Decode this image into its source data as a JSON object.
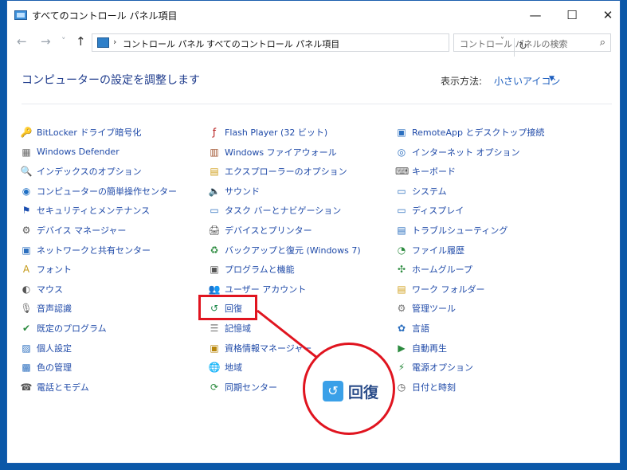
{
  "window": {
    "title": "すべてのコントロール パネル項目",
    "controls": {
      "minimize": "—",
      "maximize": "☐",
      "close": "✕"
    }
  },
  "nav": {
    "back": "←",
    "forward": "→",
    "recent": "˅",
    "up": "↑",
    "breadcrumb": [
      "コントロール パネル",
      "すべてのコントロール パネル項目"
    ],
    "separator": "›",
    "dropdown": "˅",
    "refresh": "↻",
    "search_placeholder": "コントロール パネルの検索",
    "search_icon": "⌕"
  },
  "header": {
    "title": "コンピューターの設定を調整します",
    "view_by_label": "表示方法:",
    "view_by_value": "小さいアイコン",
    "view_by_arrow": "▼"
  },
  "columns": [
    [
      {
        "label": "BitLocker ドライブ暗号化",
        "icon": "key-icon",
        "glyph": "🔑",
        "color": "#c9a21b"
      },
      {
        "label": "Windows Defender",
        "icon": "wall-icon",
        "glyph": "▦",
        "color": "#6b6b6b"
      },
      {
        "label": "インデックスのオプション",
        "icon": "magnifier-icon",
        "glyph": "🔍",
        "color": "#555555"
      },
      {
        "label": "コンピューターの簡単操作センター",
        "icon": "ease-of-access-icon",
        "glyph": "◉",
        "color": "#1f6fc4"
      },
      {
        "label": "セキュリティとメンテナンス",
        "icon": "flag-icon",
        "glyph": "⚑",
        "color": "#1c4fb0"
      },
      {
        "label": "デバイス マネージャー",
        "icon": "device-manager-icon",
        "glyph": "⚙",
        "color": "#555555"
      },
      {
        "label": "ネットワークと共有センター",
        "icon": "network-icon",
        "glyph": "▣",
        "color": "#2c6fbf"
      },
      {
        "label": "フォント",
        "icon": "font-icon",
        "glyph": "A",
        "color": "#c49a18"
      },
      {
        "label": "マウス",
        "icon": "mouse-icon",
        "glyph": "◐",
        "color": "#555555"
      },
      {
        "label": "音声認識",
        "icon": "microphone-icon",
        "glyph": "🎙",
        "color": "#666666"
      },
      {
        "label": "既定のプログラム",
        "icon": "default-programs-icon",
        "glyph": "✔",
        "color": "#2b8a3e"
      },
      {
        "label": "個人設定",
        "icon": "personalization-icon",
        "glyph": "▨",
        "color": "#2c6fbf"
      },
      {
        "label": "色の管理",
        "icon": "color-management-icon",
        "glyph": "▩",
        "color": "#2c6fbf"
      },
      {
        "label": "電話とモデム",
        "icon": "phone-modem-icon",
        "glyph": "☎",
        "color": "#555555"
      }
    ],
    [
      {
        "label": "Flash Player (32 ビット)",
        "icon": "flash-icon",
        "glyph": "ƒ",
        "color": "#b31212"
      },
      {
        "label": "Windows ファイアウォール",
        "icon": "firewall-icon",
        "glyph": "▥",
        "color": "#a0522d"
      },
      {
        "label": "エクスプローラーのオプション",
        "icon": "folder-options-icon",
        "glyph": "▤",
        "color": "#d1a11f"
      },
      {
        "label": "サウンド",
        "icon": "speaker-icon",
        "glyph": "🔈",
        "color": "#777777"
      },
      {
        "label": "タスク バーとナビゲーション",
        "icon": "taskbar-icon",
        "glyph": "▭",
        "color": "#2c6fbf"
      },
      {
        "label": "デバイスとプリンター",
        "icon": "printer-icon",
        "glyph": "🖨",
        "color": "#555555"
      },
      {
        "label": "バックアップと復元 (Windows 7)",
        "icon": "backup-icon",
        "glyph": "♻",
        "color": "#2b8a3e"
      },
      {
        "label": "プログラムと機能",
        "icon": "programs-icon",
        "glyph": "▣",
        "color": "#555555"
      },
      {
        "label": "ユーザー アカウント",
        "icon": "user-accounts-icon",
        "glyph": "👥",
        "color": "#2c6fbf"
      },
      {
        "label": "回復",
        "icon": "recovery-icon",
        "glyph": "↺",
        "color": "#1f8a4c"
      },
      {
        "label": "記憶域",
        "icon": "storage-icon",
        "glyph": "☰",
        "color": "#777777"
      },
      {
        "label": "資格情報マネージャー",
        "icon": "credential-icon",
        "glyph": "▣",
        "color": "#b8860b"
      },
      {
        "label": "地域",
        "icon": "globe-icon",
        "glyph": "🌐",
        "color": "#2c6fbf"
      },
      {
        "label": "同期センター",
        "icon": "sync-icon",
        "glyph": "⟳",
        "color": "#2b8a3e"
      }
    ],
    [
      {
        "label": "RemoteApp とデスクトップ接続",
        "icon": "remoteapp-icon",
        "glyph": "▣",
        "color": "#2c6fbf"
      },
      {
        "label": "インターネット オプション",
        "icon": "internet-options-icon",
        "glyph": "◎",
        "color": "#2c6fbf"
      },
      {
        "label": "キーボード",
        "icon": "keyboard-icon",
        "glyph": "⌨",
        "color": "#555555"
      },
      {
        "label": "システム",
        "icon": "system-icon",
        "glyph": "▭",
        "color": "#2c6fbf"
      },
      {
        "label": "ディスプレイ",
        "icon": "display-icon",
        "glyph": "▭",
        "color": "#2c6fbf"
      },
      {
        "label": "トラブルシューティング",
        "icon": "troubleshooting-icon",
        "glyph": "▤",
        "color": "#2c6fbf"
      },
      {
        "label": "ファイル履歴",
        "icon": "file-history-icon",
        "glyph": "◔",
        "color": "#2b8a3e"
      },
      {
        "label": "ホームグループ",
        "icon": "homegroup-icon",
        "glyph": "✣",
        "color": "#2b8a3e"
      },
      {
        "label": "ワーク フォルダー",
        "icon": "work-folders-icon",
        "glyph": "▤",
        "color": "#d1a11f"
      },
      {
        "label": "管理ツール",
        "icon": "admin-tools-icon",
        "glyph": "⚙",
        "color": "#777777"
      },
      {
        "label": "言語",
        "icon": "language-icon",
        "glyph": "✿",
        "color": "#2c6fbf"
      },
      {
        "label": "自動再生",
        "icon": "autoplay-icon",
        "glyph": "▶",
        "color": "#2b8a3e"
      },
      {
        "label": "電源オプション",
        "icon": "power-icon",
        "glyph": "⚡",
        "color": "#2b8a3e"
      },
      {
        "label": "日付と時刻",
        "icon": "clock-icon",
        "glyph": "◷",
        "color": "#555555"
      }
    ]
  ],
  "callout": {
    "label": "回復",
    "icon_glyph": "↺",
    "accent": "#e0141f"
  }
}
